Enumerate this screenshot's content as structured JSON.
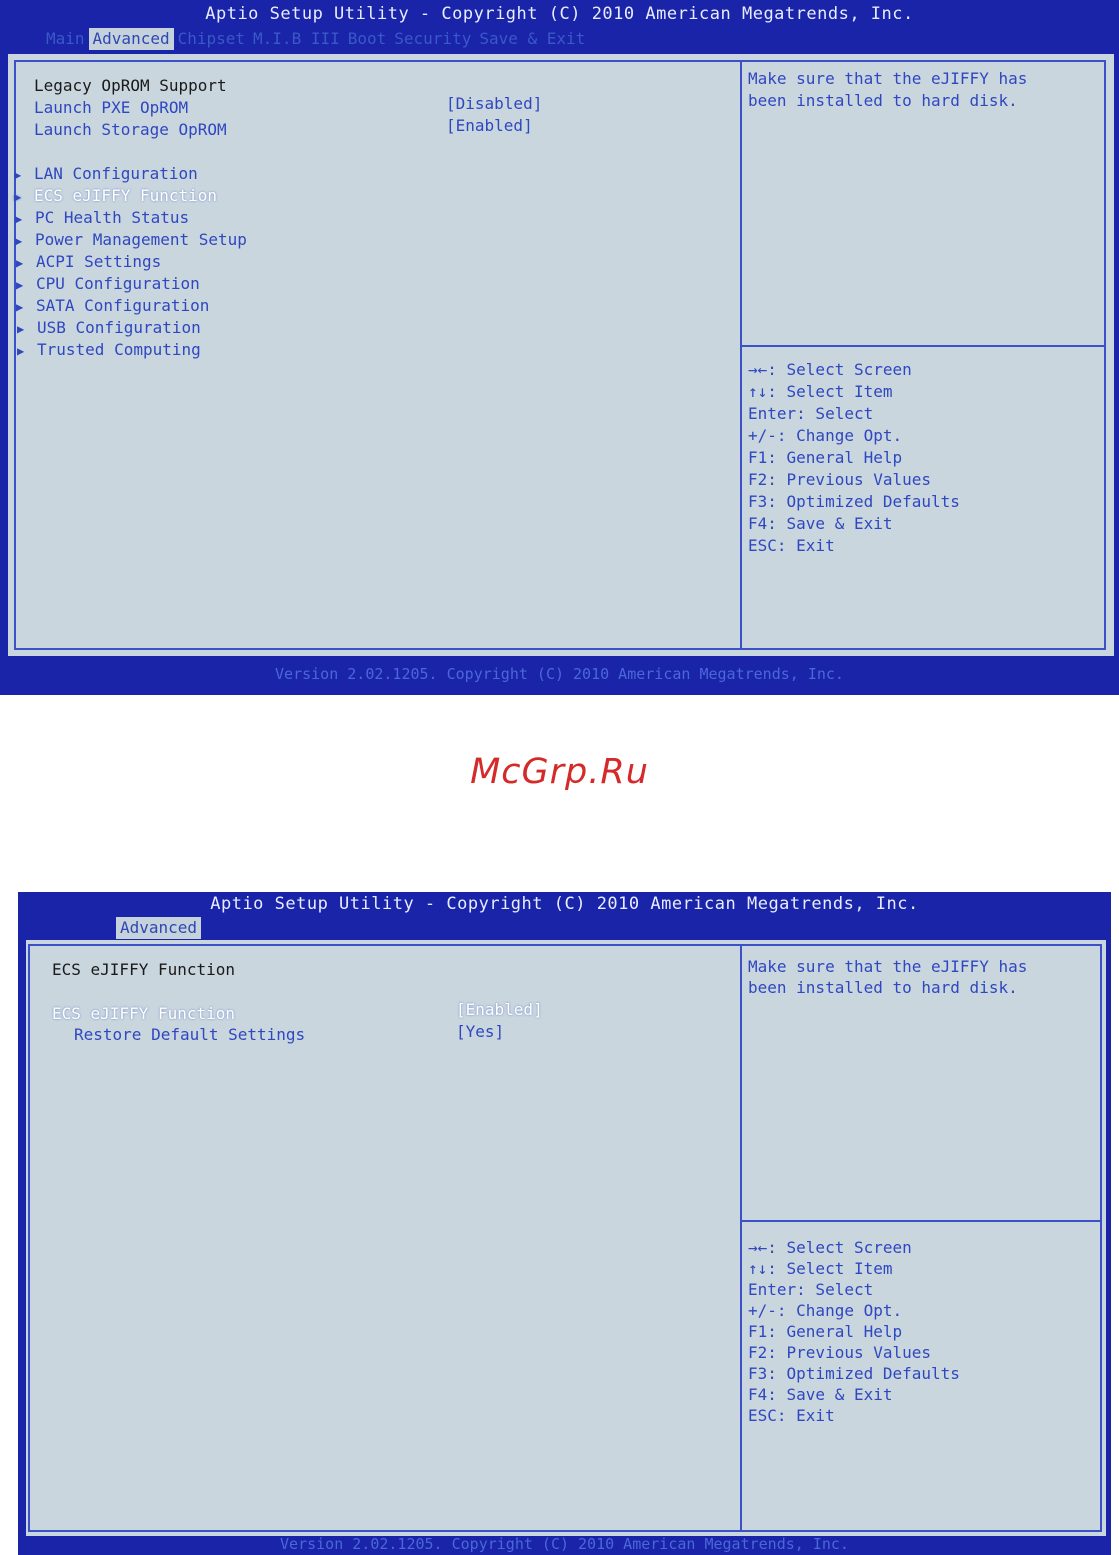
{
  "screen1": {
    "title": "Aptio Setup Utility - Copyright (C) 2010 American Megatrends, Inc.",
    "tabs": [
      "Main",
      "Advanced",
      "Chipset",
      "M.I.B III",
      "Boot",
      "Security",
      "Save & Exit"
    ],
    "active_tab": "Advanced",
    "section_header": "Legacy OpROM Support",
    "options": [
      {
        "label": "Launch PXE OpROM",
        "value": "[Disabled]"
      },
      {
        "label": "Launch Storage OpROM",
        "value": "[Enabled]"
      }
    ],
    "submenus": [
      "LAN Configuration",
      "ECS eJIFFY Function",
      "PC Health Status",
      "Power Management Setup",
      "ACPI Settings",
      "CPU Configuration",
      "SATA Configuration",
      "USB Configuration",
      "Trusted Computing"
    ],
    "selected_submenu": "ECS eJIFFY Function",
    "help_lines": [
      "Make sure that the eJIFFY has",
      "been installed to hard disk."
    ],
    "key_help": [
      "→←: Select Screen",
      "↑↓: Select Item",
      "Enter: Select",
      "+/-: Change Opt.",
      "F1: General Help",
      "F2: Previous Values",
      "F3: Optimized Defaults",
      "F4: Save & Exit",
      "ESC: Exit"
    ],
    "footer": "Version 2.02.1205. Copyright (C) 2010 American Megatrends, Inc."
  },
  "watermark": "McGrp.Ru",
  "screen2": {
    "title": "Aptio Setup Utility - Copyright (C) 2010 American Megatrends, Inc.",
    "tab": "Advanced",
    "section_header": "ECS eJIFFY Function",
    "options": [
      {
        "label": "ECS eJIFFY Function",
        "value": "[Enabled]"
      },
      {
        "label": "Restore Default Settings",
        "value": "[Yes]"
      }
    ],
    "help_lines": [
      "Make sure that the eJIFFY has",
      "been installed to hard disk."
    ],
    "key_help": [
      "→←: Select Screen",
      "↑↓: Select Item",
      "Enter: Select",
      "+/-: Change Opt.",
      "F1: General Help",
      "F2: Previous Values",
      "F3: Optimized Defaults",
      "F4: Save & Exit",
      "ESC: Exit"
    ],
    "footer": "Version 2.02.1205. Copyright (C) 2010 American Megatrends, Inc."
  },
  "colors": {
    "screen_blue": "#1a24a8",
    "panel_bg": "#c9d6de",
    "item_blue": "#2f47c0",
    "selected_white": "#ffffff",
    "watermark_red": "#d42a2a"
  }
}
